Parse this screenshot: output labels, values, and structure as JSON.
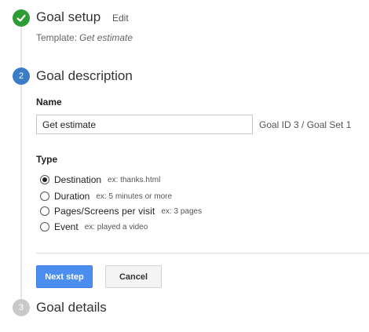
{
  "steps": [
    {
      "number": "✓",
      "title": "Goal setup",
      "status_color": "#2e9c34"
    },
    {
      "number": "2",
      "title": "Goal description",
      "status_color": "#3a7cc6"
    },
    {
      "number": "3",
      "title": "Goal details",
      "status_color": "#c9c9c9"
    }
  ],
  "goal_setup": {
    "edit_label": "Edit",
    "template_label": "Template:",
    "template_value": "Get estimate"
  },
  "goal_description": {
    "name_label": "Name",
    "name_value": "Get estimate",
    "goal_id_text": "Goal ID 3 / Goal Set 1",
    "type_label": "Type",
    "types": [
      {
        "label": "Destination",
        "example": "ex: thanks.html",
        "selected": true
      },
      {
        "label": "Duration",
        "example": "ex: 5 minutes or more",
        "selected": false
      },
      {
        "label": "Pages/Screens per visit",
        "example": "ex: 3 pages",
        "selected": false
      },
      {
        "label": "Event",
        "example": "ex: played a video",
        "selected": false
      }
    ]
  },
  "actions": {
    "next_label": "Next step",
    "cancel_label": "Cancel"
  },
  "colors": {
    "accent": "#4b8ef0",
    "complete": "#2e9c34",
    "current": "#3a7cc6",
    "pending": "#c9c9c9"
  }
}
